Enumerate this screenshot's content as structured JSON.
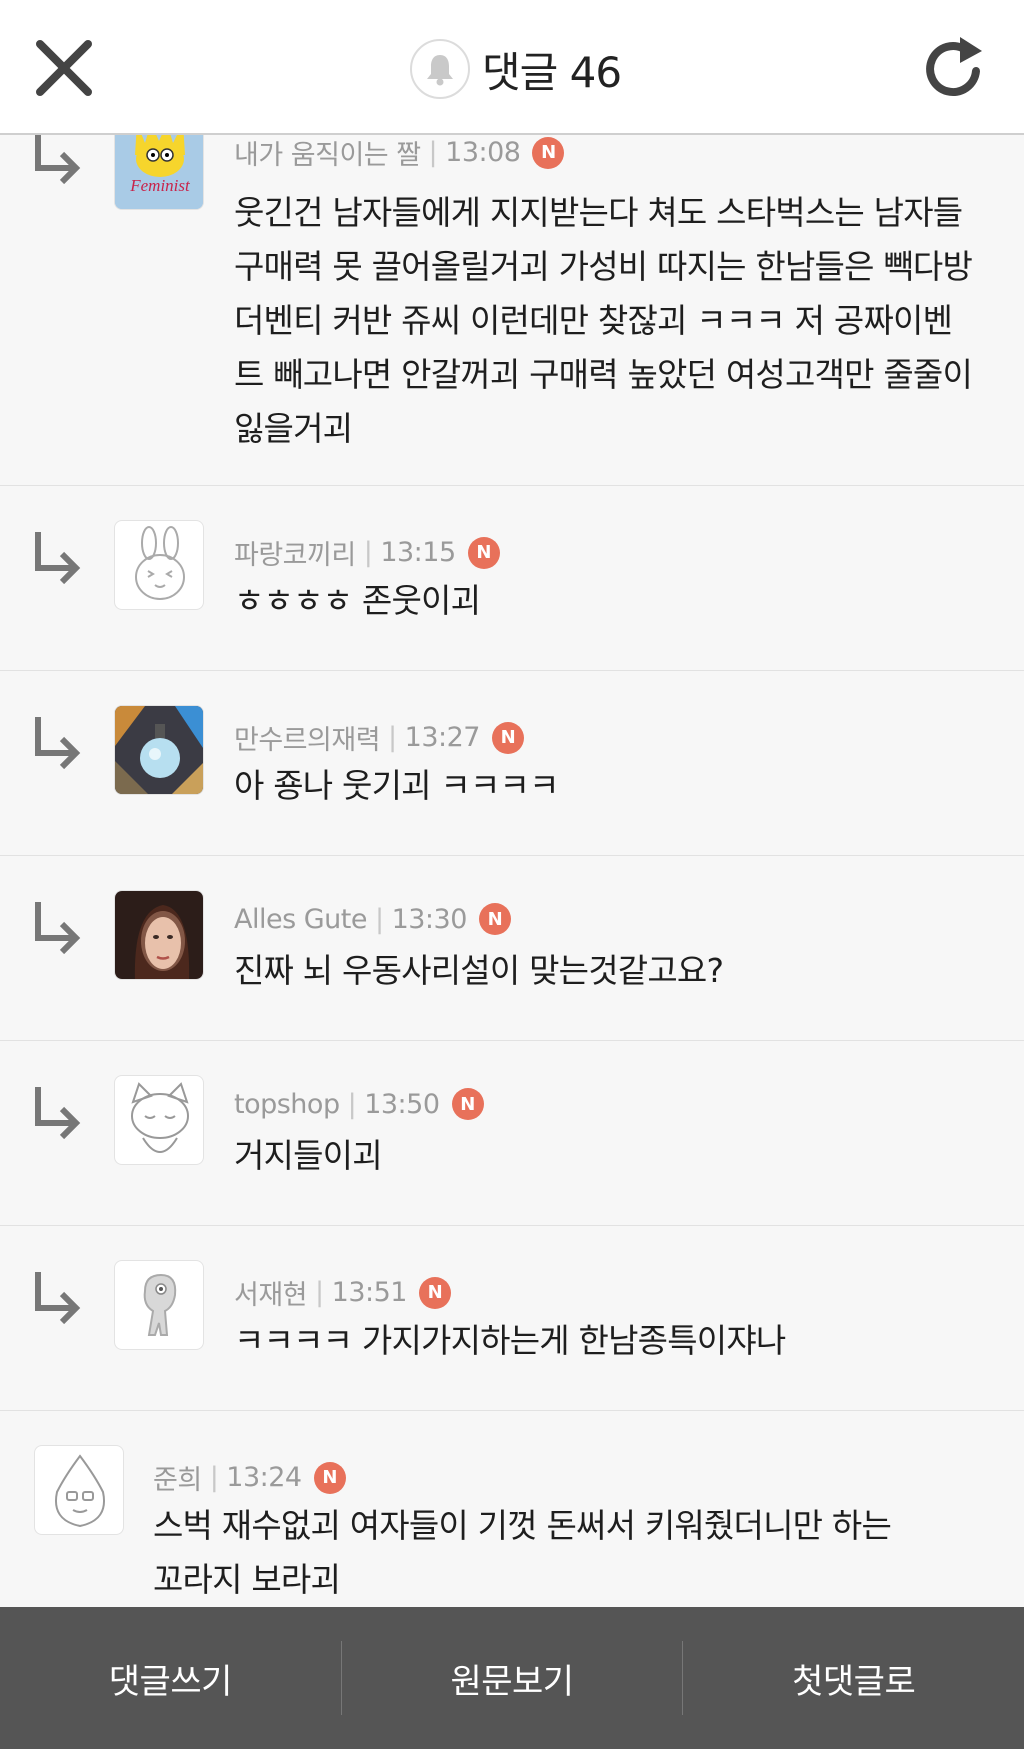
{
  "header": {
    "title": "댓글 46",
    "close_icon": "close-icon",
    "bell_icon": "bell-icon",
    "refresh_icon": "refresh-icon"
  },
  "comments": [
    {
      "author": "내가 움직이는 짤",
      "time": "13:08",
      "new_badge": "N",
      "body": "웃긴건 남자들에게 지지받는다 쳐도 스타벅스는 남자들 구매력 못 끌어올릴거괴 가성비 따지는 한남들은 빽다방 더벤티 커반 쥬씨 이런데만 찾잖괴 ㅋㅋㅋ 저 공짜이벤트 빼고나면 안갈꺼괴 구매력 높았던 여성고객만 줄줄이 잃을거괴",
      "avatar": "feminist-avatar",
      "avatar_text": "Feminist"
    },
    {
      "author": "파랑코끼리",
      "time": "13:15",
      "new_badge": "N",
      "body": "ㅎㅎㅎㅎ 존웃이괴",
      "avatar": "rabbit-avatar"
    },
    {
      "author": "만수르의재력",
      "time": "13:27",
      "new_badge": "N",
      "body": "아 죵나 웃기괴 ㅋㅋㅋㅋ",
      "avatar": "perfume-avatar"
    },
    {
      "author": "Alles Gute",
      "time": "13:30",
      "new_badge": "N",
      "body": "진짜 뇌 우동사리설이 맞는것같고요?",
      "avatar": "woman-portrait-avatar"
    },
    {
      "author": "topshop",
      "time": "13:50",
      "new_badge": "N",
      "body": "거지들이괴",
      "avatar": "cat-avatar"
    },
    {
      "author": "서재현",
      "time": "13:51",
      "new_badge": "N",
      "body": "ㅋㅋㅋㅋ 가지가지하는게 한남종특이쟈나",
      "avatar": "character-avatar"
    },
    {
      "author": "준희",
      "time": "13:24",
      "new_badge": "N",
      "body": "스벅 재수없괴 여자들이 기껏 돈써서 키워줬더니만 하는 꼬라지 보라괴",
      "avatar": "peach-avatar"
    }
  ],
  "footer": {
    "write": "댓글쓰기",
    "original": "원문보기",
    "first": "첫댓글로"
  },
  "colors": {
    "badge": "#e8715a",
    "footer": "#555555",
    "background": "#f7f7f7"
  }
}
